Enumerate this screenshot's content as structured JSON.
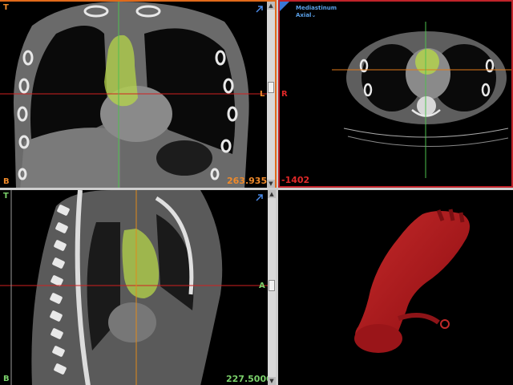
{
  "coronal": {
    "top_label": "T",
    "bottom_label": "B",
    "left_label": "L",
    "right_label": "R",
    "value": "263.9355"
  },
  "axial": {
    "preset": "Mediastinum",
    "view": "Axial",
    "dropdown_glyph": "⌄",
    "value": "-1402"
  },
  "sagittal": {
    "top_label": "T",
    "bottom_label": "B",
    "anterior_label": "A",
    "value": "227.5000"
  },
  "colors": {
    "coronal_accent": "#e06a1a",
    "axial_accent": "#c0232a",
    "sagittal_accent": "#7ad06a",
    "segmentation": "#b5d64a",
    "volume_render": "#a3181b"
  },
  "icons": {
    "expand": "expand-arrow-icon"
  }
}
